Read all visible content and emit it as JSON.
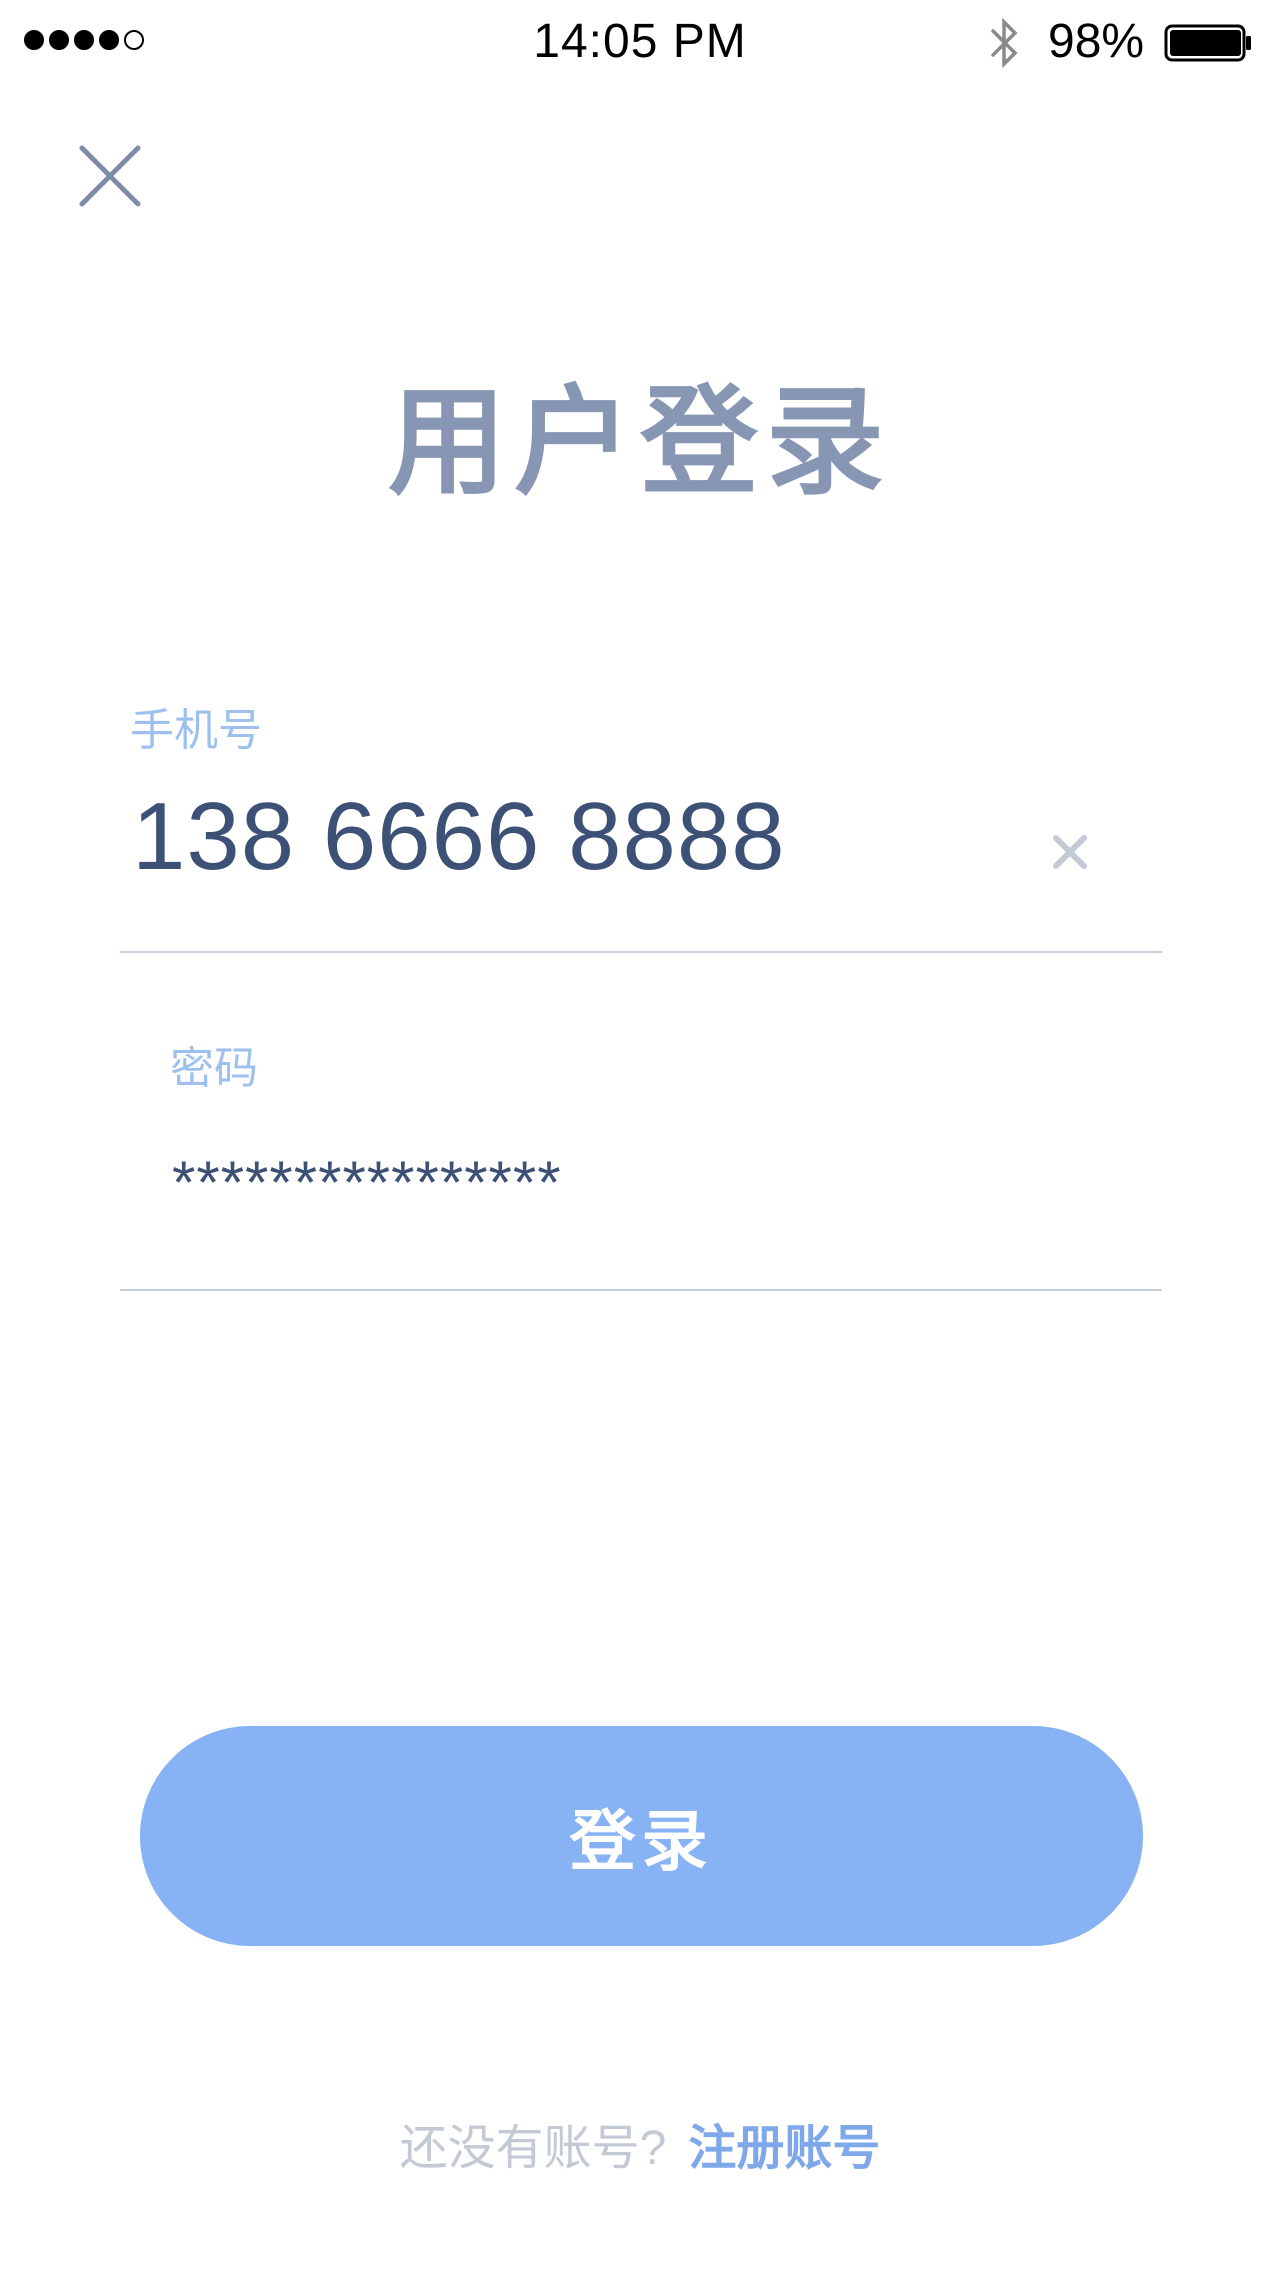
{
  "status_bar": {
    "time": "14:05 PM",
    "battery_percent": "98%",
    "signal_bars_filled": 4,
    "signal_bars_total": 5,
    "battery_level": 0.98
  },
  "header": {
    "close_icon": "close-icon",
    "title": "用户登录"
  },
  "form": {
    "phone": {
      "label": "手机号",
      "value": "138 6666 8888",
      "clear_icon": "clear-icon"
    },
    "password": {
      "label": "密码",
      "value": "****************"
    }
  },
  "login_button": {
    "label": "登录"
  },
  "footer": {
    "prompt": "还没有账号?",
    "register_link": "注册账号"
  },
  "colors": {
    "accent": "#87b3f4",
    "title": "#8796b2",
    "label": "#9dc0ef",
    "value": "#3d5075",
    "link": "#7ea8ea"
  }
}
